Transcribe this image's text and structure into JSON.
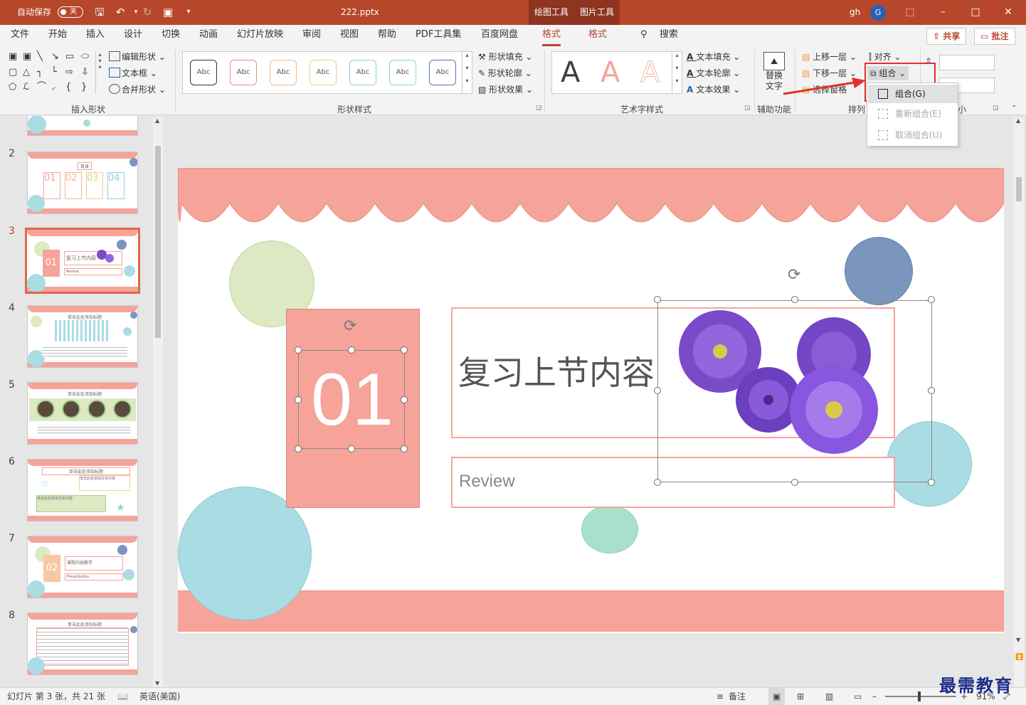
{
  "titlebar": {
    "autosave_label": "自动保存",
    "autosave_state": "关",
    "filename": "222.pptx",
    "context_tab_drawing": "绘图工具",
    "context_tab_picture": "图片工具",
    "user_initials": "gh",
    "avatar_letter": "G",
    "accent_color": "#b7472a"
  },
  "menu": {
    "tabs": [
      "文件",
      "开始",
      "插入",
      "设计",
      "切换",
      "动画",
      "幻灯片放映",
      "审阅",
      "视图",
      "帮助",
      "PDF工具集",
      "百度网盘",
      "格式",
      "格式"
    ],
    "active_tab": "格式",
    "search_label": "搜索",
    "share_label": "共享",
    "comment_label": "批注"
  },
  "ribbon": {
    "insert_shapes": {
      "label": "插入形状",
      "edit_shape": "编辑形状",
      "text_box": "文本框",
      "merge_shapes": "合并形状"
    },
    "shape_styles": {
      "label": "形状样式",
      "chip_text": "Abc",
      "chip_colors": [
        "#333333",
        "#f08c84",
        "#f5b88c",
        "#e8cf88",
        "#8fd3c6",
        "#8fd0e0",
        "#5a7ab8"
      ],
      "fill": "形状填充",
      "outline": "形状轮廓",
      "effects": "形状效果"
    },
    "wordart": {
      "label": "艺术字样式",
      "letter": "A",
      "text_fill": "文本填充",
      "text_outline": "文本轮廓",
      "text_effects": "文本效果"
    },
    "accessibility": {
      "label": "辅助功能",
      "alt_text_line1": "替换",
      "alt_text_line2": "文字"
    },
    "arrange": {
      "label": "排列",
      "bring_forward": "上移一层",
      "send_backward": "下移一层",
      "selection_pane": "选择窗格",
      "align": "对齐",
      "group": "组合",
      "size_label": "小"
    }
  },
  "group_dropdown": {
    "items": [
      {
        "label": "组合(G)",
        "state": "highlighted"
      },
      {
        "label": "重新组合(E)",
        "state": "disabled"
      },
      {
        "label": "取消组合(U)",
        "state": "disabled"
      }
    ]
  },
  "thumbnails": {
    "numbers": [
      "2",
      "3",
      "4",
      "5",
      "6",
      "7",
      "8"
    ],
    "selected": "3",
    "slide2_title": "目录",
    "slide2_items": [
      "01",
      "02",
      "03",
      "04"
    ],
    "slide3_num": "01",
    "slide3_title": "复习上节内容",
    "slide3_sub": "Review",
    "slide_generic_title": "单击此处添加标题",
    "slide6_text1": "单击此处添加文本内容",
    "slide6_text2": "单击此处添加文本内容",
    "slide7_num": "02",
    "slide7_title": "课程内容教学",
    "slide7_sub": "Presentation"
  },
  "slide": {
    "number_text": "01",
    "title": "复习上节内容",
    "subtitle": "Review",
    "colors": {
      "salmon": "#f6a39a",
      "green": "#dce9c2",
      "blue": "#aadce4",
      "navy": "#7a96bd",
      "mint": "#a9e0cc",
      "flower": "#7a4bc9"
    }
  },
  "statusbar": {
    "slide_info": "幻灯片 第 3 张，共 21 张",
    "language": "英语(美国)",
    "notes": "备注",
    "zoom": "91%"
  },
  "watermark": "最需教育"
}
